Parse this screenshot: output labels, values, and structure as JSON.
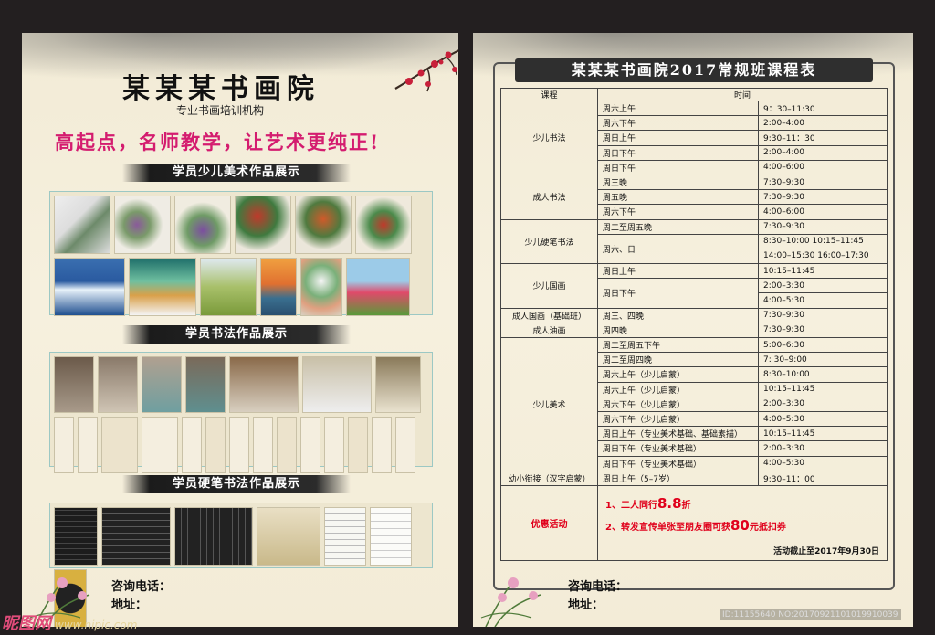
{
  "left": {
    "title": "某某某书画院",
    "subtitle": "——专业书画培训机构——",
    "slogan": "高起点，名师教学，让艺术更纯正!",
    "sections": [
      {
        "label": "学员少儿美术作品展示"
      },
      {
        "label": "学员书法作品展示"
      },
      {
        "label": "学员硬笔书法作品展示"
      }
    ],
    "contact_phone_label": "咨询电话：",
    "address_label": "地址：",
    "watermark": "昵图网",
    "watermark_url": "www.nipic.com"
  },
  "right": {
    "title": "某某某书画院2017常规班课程表",
    "col_course": "课程",
    "col_time": "时间",
    "contact_phone_label": "咨询电话：",
    "address_label": "地址：",
    "id_tag": "ID:11155640 NO:20170921101019910039",
    "rows": [
      {
        "course": "少儿书法",
        "day": "周六上午",
        "time": "9：30–11:30"
      },
      {
        "course": "",
        "day": "周六下午",
        "time": "2:00–4:00"
      },
      {
        "course": "",
        "day": "周日上午",
        "time": "9:30–11：30"
      },
      {
        "course": "",
        "day": "周日下午",
        "time": "2:00–4:00"
      },
      {
        "course": "",
        "day": "周日下午",
        "time": "4:00–6:00"
      },
      {
        "course": "成人书法",
        "day": "周三晚",
        "time": "7:30–9:30"
      },
      {
        "course": "",
        "day": "周五晚",
        "time": "7:30–9:30"
      },
      {
        "course": "",
        "day": "周六下午",
        "time": "4:00–6:00"
      },
      {
        "course": "少儿硬笔书法",
        "day": "周二至周五晚",
        "time": "7:30–9:30"
      },
      {
        "course": "",
        "day": "周六、日",
        "time": "8:30–10:00     10:15–11:45"
      },
      {
        "course": "",
        "day": "",
        "time": "14:00–15:30     16:00–17:30"
      },
      {
        "course": "少儿国画",
        "day": "周日上午",
        "time": "10:15–11:45"
      },
      {
        "course": "",
        "day": "周日下午",
        "time": "2:00–3:30"
      },
      {
        "course": "",
        "day": "",
        "time": "4:00–5:30"
      },
      {
        "course": "成人国画（基础班）",
        "day": "周三、四晚",
        "time": "7:30–9:30"
      },
      {
        "course": "成人油画",
        "day": "周四晚",
        "time": "7:30–9:30"
      },
      {
        "course": "少儿美术",
        "day": "周二至周五下午",
        "time": "5:00–6:30"
      },
      {
        "course": "",
        "day": "周二至周四晚",
        "time": "7: 30–9:00"
      },
      {
        "course": "",
        "day": "周六上午（少儿启蒙）",
        "time": "8:30–10:00"
      },
      {
        "course": "",
        "day": "周六上午（少儿启蒙）",
        "time": "10:15–11:45"
      },
      {
        "course": "",
        "day": "周六下午（少儿启蒙）",
        "time": "2:00–3:30"
      },
      {
        "course": "",
        "day": "周六下午（少儿启蒙）",
        "time": "4:00–5:30"
      },
      {
        "course": "",
        "day": "周日上午（专业美术基础、基础素描）",
        "time": "10:15–11:45"
      },
      {
        "course": "",
        "day": "周日下午（专业美术基础）",
        "time": "2:00–3:30"
      },
      {
        "course": "",
        "day": "周日下午（专业美术基础）",
        "time": "4:00–5:30"
      },
      {
        "course": "幼小衔接（汉字启蒙）",
        "day": "周日上午（5–7岁）",
        "time": "9:30–11：00"
      }
    ],
    "promo_label": "优惠活动",
    "promo1_prefix": "1、二人同行",
    "promo1_value": "8.8",
    "promo1_suffix": "折",
    "promo2_prefix": "2、转发宣传单张至朋友圈可获",
    "promo2_value": "80",
    "promo2_suffix": "元抵扣券",
    "deadline": "活动截止至2017年9月30日"
  },
  "colors": {
    "slogan": "#d41c6f",
    "promo": "#e0001b",
    "frame": "#555555"
  }
}
